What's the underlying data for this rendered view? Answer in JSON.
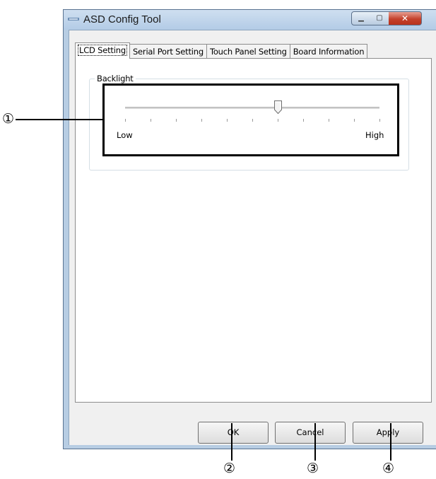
{
  "window": {
    "title": "ASD Config Tool",
    "caption_buttons": {
      "minimize": "▁",
      "maximize": "▢",
      "close": "✕"
    }
  },
  "tabs": [
    {
      "label": "LCD Setting",
      "active": true
    },
    {
      "label": "Serial Port Setting",
      "active": false
    },
    {
      "label": "Touch Panel Setting",
      "active": false
    },
    {
      "label": "Board Information",
      "active": false
    }
  ],
  "backlight": {
    "group_label": "Backlight",
    "low_label": "Low",
    "high_label": "High",
    "tick_count": 11,
    "value_fraction": 0.6
  },
  "buttons": {
    "ok": "OK",
    "cancel": "Cancel",
    "apply": "Apply"
  },
  "callouts": [
    "①",
    "②",
    "③",
    "④"
  ],
  "colors": {
    "titlebar": "#b7cde3",
    "close_button": "#c4412b",
    "panel_bg": "#f0f0f0"
  }
}
